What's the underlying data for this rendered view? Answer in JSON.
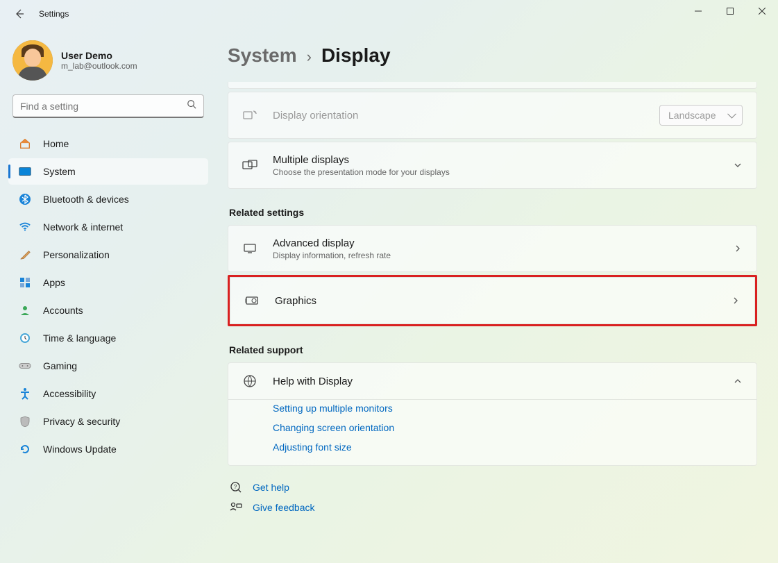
{
  "titlebar": {
    "title": "Settings"
  },
  "user": {
    "name": "User Demo",
    "email": "m_lab@outlook.com"
  },
  "search": {
    "placeholder": "Find a setting"
  },
  "nav": [
    {
      "id": "home",
      "label": "Home"
    },
    {
      "id": "system",
      "label": "System"
    },
    {
      "id": "bluetooth",
      "label": "Bluetooth & devices"
    },
    {
      "id": "network",
      "label": "Network & internet"
    },
    {
      "id": "personalization",
      "label": "Personalization"
    },
    {
      "id": "apps",
      "label": "Apps"
    },
    {
      "id": "accounts",
      "label": "Accounts"
    },
    {
      "id": "time",
      "label": "Time & language"
    },
    {
      "id": "gaming",
      "label": "Gaming"
    },
    {
      "id": "accessibility",
      "label": "Accessibility"
    },
    {
      "id": "privacy",
      "label": "Privacy & security"
    },
    {
      "id": "update",
      "label": "Windows Update"
    }
  ],
  "breadcrumb": {
    "parent": "System",
    "current": "Display"
  },
  "rows": {
    "orientation": {
      "title": "Display orientation",
      "value": "Landscape"
    },
    "multiple": {
      "title": "Multiple displays",
      "sub": "Choose the presentation mode for your displays"
    }
  },
  "related_label": "Related settings",
  "related": {
    "advanced": {
      "title": "Advanced display",
      "sub": "Display information, refresh rate"
    },
    "graphics": {
      "title": "Graphics"
    }
  },
  "support_label": "Related support",
  "help": {
    "title": "Help with Display",
    "links": [
      "Setting up multiple monitors",
      "Changing screen orientation",
      "Adjusting font size"
    ]
  },
  "bottom": {
    "get_help": "Get help",
    "feedback": "Give feedback"
  }
}
